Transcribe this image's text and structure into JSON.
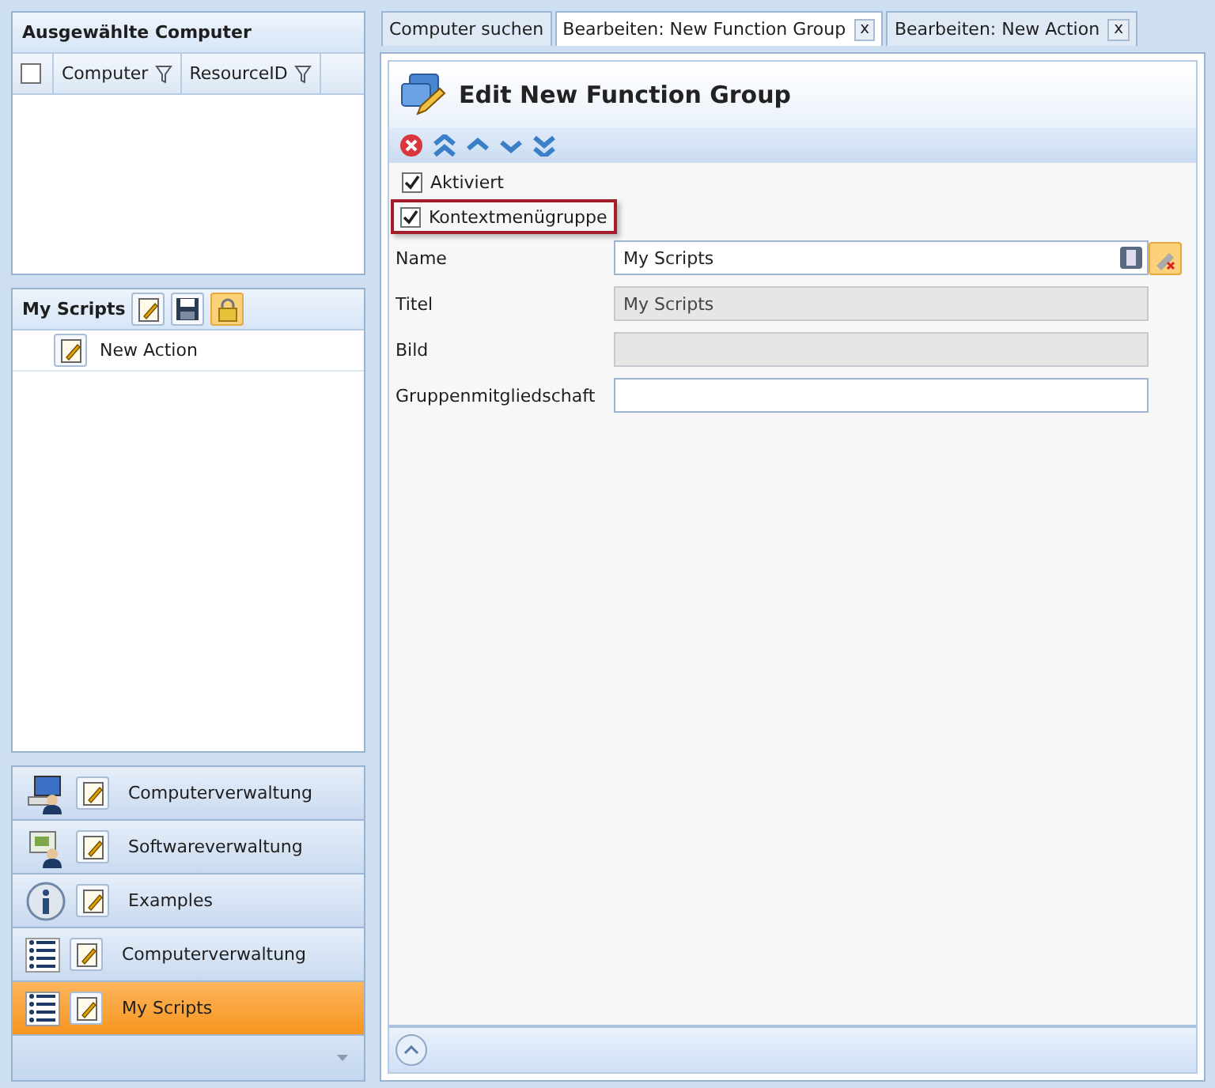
{
  "left": {
    "computers": {
      "title": "Ausgewählte Computer",
      "select_all_checked": false,
      "columns": [
        "Computer",
        "ResourceID"
      ]
    },
    "scripts": {
      "title": "My Scripts",
      "items": [
        {
          "label": "New Action"
        }
      ]
    },
    "nav": [
      {
        "label": "Computerverwaltung",
        "kind": "computer",
        "selected": false
      },
      {
        "label": "Softwareverwaltung",
        "kind": "software",
        "selected": false
      },
      {
        "label": "Examples",
        "kind": "info",
        "selected": false
      },
      {
        "label": "Computerverwaltung",
        "kind": "list",
        "selected": false
      },
      {
        "label": "My Scripts",
        "kind": "list",
        "selected": true
      }
    ]
  },
  "tabs": [
    {
      "label": "Computer suchen",
      "selected": false
    },
    {
      "label": "Bearbeiten: New Function Group",
      "selected": true,
      "close": "x"
    },
    {
      "label": "Bearbeiten: New Action",
      "selected": false,
      "close": "x"
    }
  ],
  "editor": {
    "title": "Edit New Function Group",
    "checkboxes": [
      {
        "label": "Aktiviert",
        "checked": true,
        "highlighted": false
      },
      {
        "label": "Kontextmenügruppe",
        "checked": true,
        "highlighted": true
      }
    ],
    "fields": [
      {
        "label": "Name",
        "value": "My Scripts",
        "disabled": false
      },
      {
        "label": "Titel",
        "value": "My Scripts",
        "disabled": true
      },
      {
        "label": "Bild",
        "disabled": true
      },
      {
        "label": "Gruppenmitgliedschaft",
        "disabled": false
      }
    ]
  }
}
